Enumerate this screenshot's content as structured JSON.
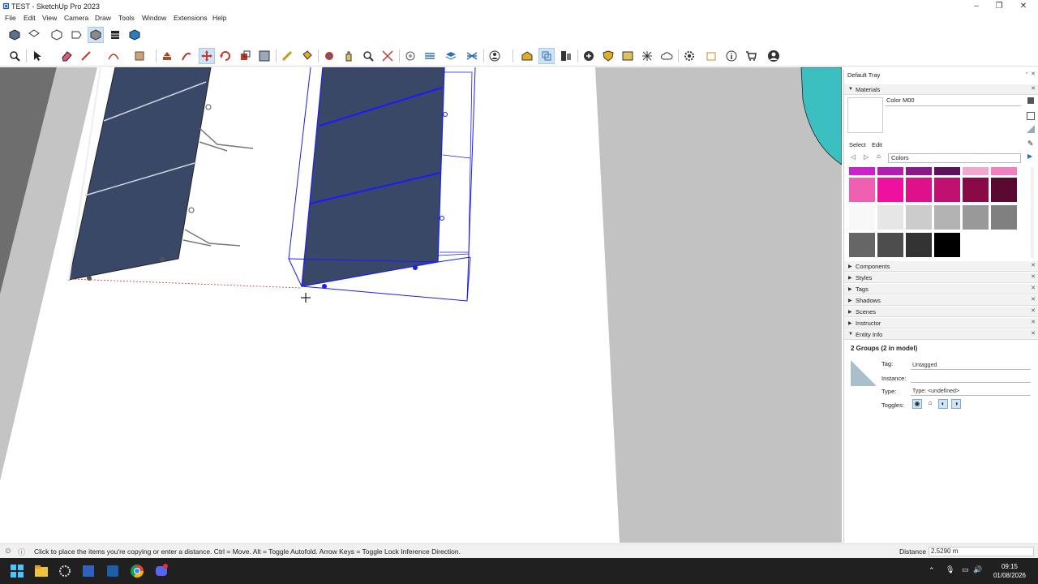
{
  "window": {
    "title": "TEST - SketchUp Pro 2023"
  },
  "menu": [
    "File",
    "Edit",
    "View",
    "Camera",
    "Draw",
    "Tools",
    "Window",
    "Extensions",
    "Help"
  ],
  "tray": {
    "title": "Default Tray",
    "materials": {
      "header": "Materials",
      "material_name": "Color M00",
      "tab_select": "Select",
      "tab_edit": "Edit",
      "library": "Colors",
      "swatches": [
        [
          "#cc22cc",
          "#b01fb0",
          "#8a1a8a",
          "#5a145a",
          "#f0a8d0",
          "#f080c0"
        ],
        [
          "#f060b0",
          "#f010a0",
          "#e0108a",
          "#c01070",
          "#8a0a48",
          "#5a0a30"
        ],
        [
          "#f8f8f8",
          "#e6e6e6",
          "#cccccc",
          "#b3b3b3",
          "#999999",
          "#808080"
        ],
        [
          "#666666",
          "#4d4d4d",
          "#333333",
          "#000000"
        ]
      ]
    },
    "panels": [
      "Components",
      "Styles",
      "Tags",
      "Shadows",
      "Scenes",
      "Instructor",
      "Entity Info"
    ],
    "entity_info": {
      "summary": "2 Groups (2 in model)",
      "tag_label": "Tag:",
      "tag_value": "Untagged",
      "instance_label": "Instance:",
      "instance_value": "",
      "type_label": "Type:",
      "type_value": "Type: <undefined>",
      "toggles_label": "Toggles:"
    }
  },
  "status": {
    "message": "Click to place the items you're copying or enter a distance. Ctrl = Move. Alt = Toggle Autofold. Arrow Keys = Toggle Lock Inference Direction.",
    "distance_label": "Distance",
    "distance_value": "2.5290 m"
  },
  "taskbar": {
    "time": "09:15",
    "date": "01/08/2026"
  },
  "colors": {
    "panel_blue": "#3a4868",
    "selection_blue": "#1a1aff",
    "teal": "#3cbfc0"
  },
  "icons": [
    "sketchup-icon",
    "minimize-icon",
    "maximize-icon",
    "close-icon",
    "select-tool-icon",
    "move-tool-icon"
  ]
}
